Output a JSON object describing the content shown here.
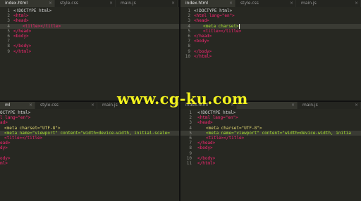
{
  "panes": {
    "top_left": {
      "tabs": [
        {
          "label": "index.html",
          "active": true
        },
        {
          "label": "style.css",
          "active": false
        },
        {
          "label": "main.js",
          "active": false
        }
      ],
      "lines": [
        {
          "n": "1",
          "text": "<!DOCTYPE html>"
        },
        {
          "n": "2",
          "text": "<html>"
        },
        {
          "n": "3",
          "text": "<head>"
        },
        {
          "n": "4",
          "text": "<title></title>"
        },
        {
          "n": "5",
          "text": "</head>"
        },
        {
          "n": "6",
          "text": "<body>"
        },
        {
          "n": "7",
          "text": ""
        },
        {
          "n": "8",
          "text": "</body>"
        },
        {
          "n": "9",
          "text": "</html>"
        }
      ]
    },
    "top_right": {
      "tabs": [
        {
          "label": "index.html",
          "active": true
        },
        {
          "label": "style.css",
          "active": false
        },
        {
          "label": "main.js",
          "active": false
        }
      ],
      "lines": [
        {
          "n": "1",
          "text": "<!DOCTYPE html>"
        },
        {
          "n": "2",
          "text": "<html lang=\"en\">"
        },
        {
          "n": "3",
          "text": "<head>"
        },
        {
          "n": "4",
          "text": "<meta charset>"
        },
        {
          "n": "5",
          "text": "<title></title>"
        },
        {
          "n": "6",
          "text": "</head>"
        },
        {
          "n": "7",
          "text": "<body>"
        },
        {
          "n": "8",
          "text": ""
        },
        {
          "n": "9",
          "text": "</body>"
        },
        {
          "n": "10",
          "text": "</html>"
        }
      ]
    },
    "bottom_left": {
      "tabs": [
        {
          "label": "ml",
          "active": true
        },
        {
          "label": "style.css",
          "active": false
        },
        {
          "label": "main.js",
          "active": false
        }
      ],
      "lines": [
        {
          "text": "OCTYPE html>"
        },
        {
          "text": "l lang=\"en\">"
        },
        {
          "text": "ad>"
        },
        {
          "text": "<meta charset=\"UTF-8\">"
        },
        {
          "text": "<meta name=\"viewport\" content=\"width=device-width, initial-scale="
        },
        {
          "text": "<title></title>"
        },
        {
          "text": "ead>"
        },
        {
          "text": "dy>"
        },
        {
          "text": ""
        },
        {
          "text": "ody>"
        },
        {
          "text": "ml>"
        }
      ]
    },
    "bottom_right": {
      "tabs": [
        {
          "label": "index.html",
          "active": false
        },
        {
          "label": "",
          "active": false
        },
        {
          "label": "main.js",
          "active": false
        }
      ],
      "lines": [
        {
          "n": "1",
          "text": "<!DOCTYPE html>"
        },
        {
          "n": "2",
          "text": "<html lang=\"en\">"
        },
        {
          "n": "3",
          "text": "<head>"
        },
        {
          "n": "4",
          "text": "<meta charset=\"UTF-8\">"
        },
        {
          "n": "5",
          "text": "<meta name=\"viewport\" content=\"width=device-width, initia"
        },
        {
          "n": "6",
          "text": "<title></title>"
        },
        {
          "n": "7",
          "text": "</head>"
        },
        {
          "n": "8",
          "text": "<body>"
        },
        {
          "n": "9",
          "text": ""
        },
        {
          "n": "10",
          "text": "</body>"
        },
        {
          "n": "11",
          "text": "</html>"
        }
      ]
    }
  },
  "watermark": "www.cg-ku.com",
  "colors": {
    "editor_bg": "#272822",
    "tag": "#f92672",
    "attribute": "#a6e22e",
    "string": "#e6db74",
    "plain": "#f8f8f2",
    "watermark": "#f2f21e"
  }
}
